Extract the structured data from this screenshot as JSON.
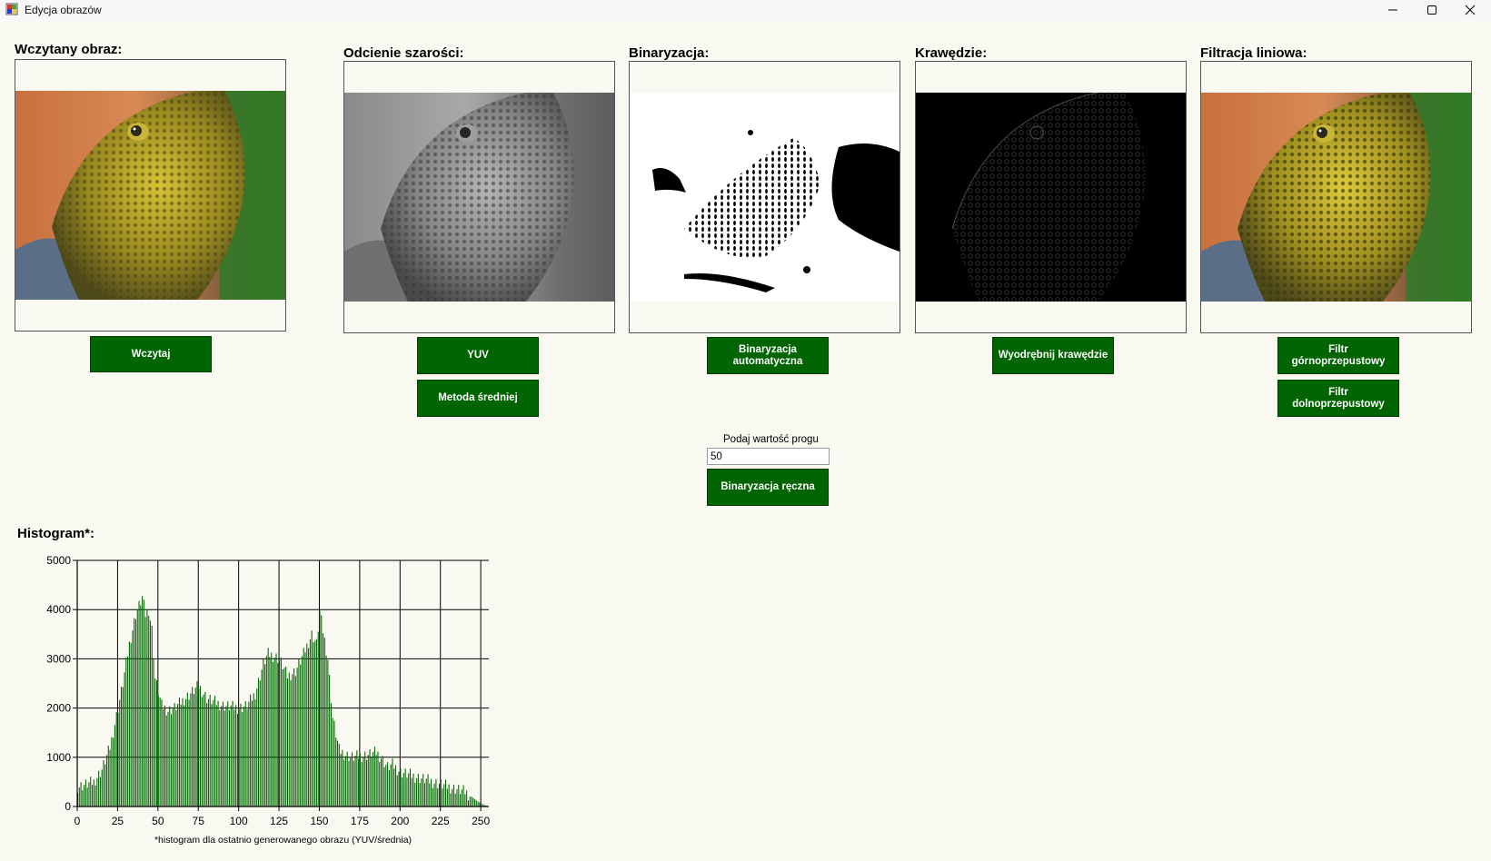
{
  "window": {
    "title": "Edycja obrazów",
    "icons": [
      "app-icon",
      "minimize-icon",
      "maximize-icon",
      "close-icon"
    ]
  },
  "panels": {
    "original": {
      "heading": "Wczytany obraz:",
      "button": "Wczytaj"
    },
    "grayscale": {
      "heading": "Odcienie szarości:",
      "button_yuv": "YUV",
      "button_avg": "Metoda średniej"
    },
    "binarization": {
      "heading": "Binaryzacja:",
      "button_auto": "Binaryzacja automatyczna"
    },
    "edges": {
      "heading": "Krawędzie:",
      "button": "Wyodrębnij krawędzie"
    },
    "filtering": {
      "heading": "Filtracja liniowa:",
      "button_high": "Filtr górnoprzepustowy",
      "button_low": "Filtr dolnoprzepustowy"
    }
  },
  "threshold": {
    "label": "Podaj wartość progu",
    "value": "50",
    "button": "Binaryzacja ręczna"
  },
  "histogram": {
    "heading": "Histogram*:",
    "footnote": "*histogram dla ostatnio generowanego obrazu (YUV/średnia)"
  },
  "colors": {
    "accent": "#006400",
    "background": "#faf9f1"
  },
  "chart_data": {
    "type": "bar",
    "xlim": [
      0,
      255
    ],
    "ylim": [
      0,
      5000
    ],
    "x_ticks": [
      0,
      25,
      50,
      75,
      100,
      125,
      150,
      175,
      200,
      225,
      250
    ],
    "y_ticks": [
      0,
      1000,
      2000,
      3000,
      4000,
      5000
    ],
    "grid": true,
    "x": [
      0,
      10,
      15,
      20,
      25,
      28,
      32,
      36,
      40,
      42,
      44,
      46,
      48,
      52,
      56,
      60,
      70,
      75,
      80,
      90,
      100,
      105,
      110,
      115,
      118,
      122,
      125,
      130,
      135,
      140,
      145,
      148,
      150,
      155,
      158,
      162,
      166,
      170,
      180,
      185,
      188,
      192,
      195,
      200,
      210,
      220,
      230,
      240,
      248,
      252,
      255
    ],
    "values": [
      400,
      500,
      750,
      1200,
      2000,
      2500,
      3300,
      3900,
      4250,
      3900,
      4000,
      3600,
      2600,
      2050,
      1950,
      2000,
      2300,
      2450,
      2200,
      2050,
      2000,
      2050,
      2300,
      2900,
      3100,
      3050,
      3000,
      2650,
      2750,
      3100,
      3500,
      3300,
      3950,
      3000,
      1800,
      1150,
      1050,
      1000,
      1050,
      1100,
      1000,
      800,
      850,
      700,
      600,
      500,
      400,
      300,
      100,
      30,
      0
    ]
  }
}
